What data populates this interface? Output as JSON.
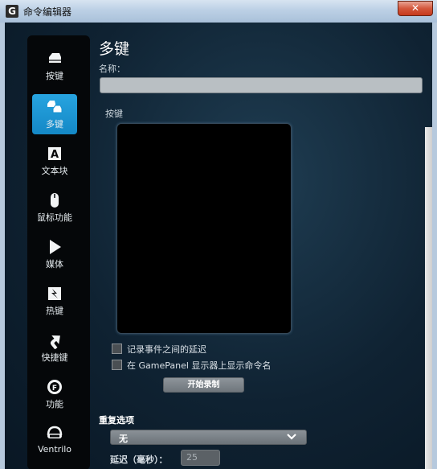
{
  "window": {
    "title": "命令编辑器",
    "app_icon": "G",
    "close_label": "✕"
  },
  "sidebar": {
    "items": [
      {
        "id": "keys",
        "label": "按键",
        "icon": "keycap-icon",
        "active": false
      },
      {
        "id": "multikey",
        "label": "多键",
        "icon": "multikey-icon",
        "active": true
      },
      {
        "id": "textblock",
        "label": "文本块",
        "icon": "text-block-icon",
        "active": false
      },
      {
        "id": "mouse",
        "label": "鼠标功能",
        "icon": "mouse-icon",
        "active": false
      },
      {
        "id": "media",
        "label": "媒体",
        "icon": "play-icon",
        "active": false
      },
      {
        "id": "hotkey",
        "label": "热键",
        "icon": "hotkey-icon",
        "active": false
      },
      {
        "id": "shortcut",
        "label": "快捷键",
        "icon": "shortcut-arrow-icon",
        "active": false
      },
      {
        "id": "function",
        "label": "功能",
        "icon": "function-gear-icon",
        "active": false
      },
      {
        "id": "ventrilo",
        "label": "Ventrilo",
        "icon": "headset-icon",
        "active": false
      }
    ]
  },
  "main": {
    "heading": "多键",
    "name_label": "名称：",
    "name_value": "",
    "keys_label": "按键",
    "options": {
      "record_delays": {
        "label": "记录事件之间的延迟",
        "checked": false
      },
      "show_on_gamepanel": {
        "label": "在 GamePanel 显示器上显示命令名",
        "checked": false
      }
    },
    "record_button": "开始录制",
    "repeat": {
      "title": "重复选项",
      "selected": "无",
      "delay_label": "延迟（毫秒）：",
      "delay_value": "25"
    }
  },
  "colors": {
    "accent": "#1e97d6",
    "sidebar_bg": "#050709",
    "content_bg": "#0f2232"
  }
}
